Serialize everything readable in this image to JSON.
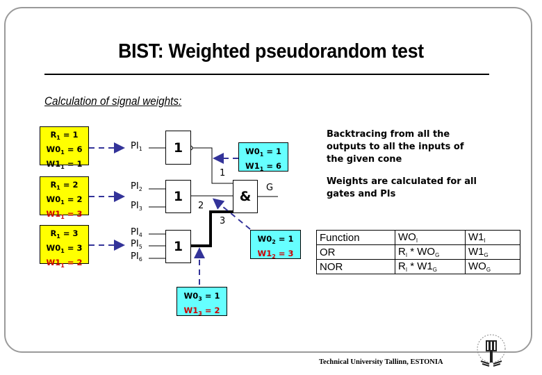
{
  "slide": {
    "title": "BIST: Weighted pseudorandom test",
    "subtitle": "Calculation of signal weights:",
    "footer": "Technical University Tallinn, ESTONIA",
    "logo": "university-seal-icon"
  },
  "colors": {
    "weight_box_inputs": "#ffff00",
    "weight_box_gates": "#66ffff",
    "highlight_text": "#cc0000",
    "arrow": "#333399",
    "frame": "#9a9a9a"
  },
  "input_weight_boxes": [
    {
      "r": "R",
      "r_sub": "1",
      "r_val": "= 1",
      "w0": "W0",
      "w0_sub": "1",
      "w0_val": "= 6",
      "w1": "W1",
      "w1_sub": "1",
      "w1_val": "= 1",
      "w1_highlight": false
    },
    {
      "r": "R",
      "r_sub": "1",
      "r_val": "= 2",
      "w0": "W0",
      "w0_sub": "1",
      "w0_val": "= 2",
      "w1": "W1",
      "w1_sub": "1",
      "w1_val": "= 3",
      "w1_highlight": true
    },
    {
      "r": "R",
      "r_sub": "1",
      "r_val": "= 3",
      "w0": "W0",
      "w0_sub": "1",
      "w0_val": "= 3",
      "w1": "W1",
      "w1_sub": "1",
      "w1_val": "= 2",
      "w1_highlight": true
    }
  ],
  "primary_inputs": [
    {
      "name": "PI",
      "sub": "1"
    },
    {
      "name": "PI",
      "sub": "2"
    },
    {
      "name": "PI",
      "sub": "3"
    },
    {
      "name": "PI",
      "sub": "4"
    },
    {
      "name": "PI",
      "sub": "5"
    },
    {
      "name": "PI",
      "sub": "6"
    }
  ],
  "gates": [
    {
      "id": "nor1",
      "symbol": "1",
      "type": "NOR"
    },
    {
      "id": "or2",
      "symbol": "1",
      "type": "OR"
    },
    {
      "id": "or3",
      "symbol": "1",
      "type": "OR"
    },
    {
      "id": "and",
      "symbol": "&",
      "type": "AND"
    }
  ],
  "signal_labels": {
    "s1": "1",
    "s2": "2",
    "s3": "3",
    "output": "G"
  },
  "gate_weight_boxes": [
    {
      "w0": "W0",
      "w0_sub": "1",
      "w0_val": "= 1",
      "w1": "W1",
      "w1_sub": "1",
      "w1_val": "= 6",
      "w1_highlight": false
    },
    {
      "w0": "W0",
      "w0_sub": "2",
      "w0_val": "= 1",
      "w1": "W1",
      "w1_sub": "2",
      "w1_val": "= 3",
      "w1_highlight": true
    },
    {
      "w0": "W0",
      "w0_sub": "3",
      "w0_val": "= 1",
      "w1": "W1",
      "w1_sub": "3",
      "w1_val": "= 2",
      "w1_highlight": true
    }
  ],
  "notes": [
    "Backtracing from all the outputs to all the inputs of the given cone",
    "Weights are calculated for all gates and PIs"
  ],
  "function_table": {
    "headers": [
      "Function",
      "WO",
      "W1"
    ],
    "header_subs": [
      "",
      "I",
      "I"
    ],
    "rows": [
      {
        "fn": "OR",
        "c1": "R",
        "c1_sub": "I",
        "c1_op": " * WO",
        "c1_sub2": "G",
        "c2": "W1",
        "c2_sub": "G"
      },
      {
        "fn": "NOR",
        "c1": "R",
        "c1_sub": "I",
        "c1_op": " * W1",
        "c1_sub2": "G",
        "c2": "WO",
        "c2_sub": "G"
      }
    ]
  }
}
